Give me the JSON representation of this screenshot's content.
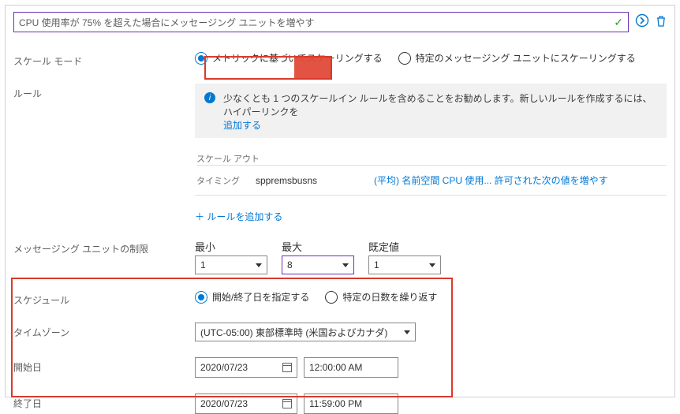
{
  "title_input": "CPU 使用率が 75% を超えた場合にメッセージング ユニットを増やす",
  "labels": {
    "scale_mode": "スケール モード",
    "rules": "ルール",
    "unit_limit": "メッセージング ユニットの制限",
    "schedule": "スケジュール",
    "timezone": "タイムゾーン",
    "start_date": "開始日",
    "end_date": "終了日"
  },
  "scale_mode": {
    "opt_metric": "メトリックに基づいてスケーリングする",
    "opt_specific": "特定のメッセージング ユニットにスケーリングする"
  },
  "info": {
    "text": "少なくとも 1 つのスケールイン ルールを含めることをお勧めします。新しいルールを作成するには、ハイパーリンクを",
    "add_link": "追加する"
  },
  "rules_section": {
    "scale_out": "スケール アウト",
    "timing_label": "タイミング",
    "timing_source": "sppremsbusns",
    "timing_detail": "(平均) 名前空間 CPU 使用... 許可された次の値を増やす",
    "add_rule": "＋ ルールを追加する"
  },
  "limits": {
    "min_label": "最小",
    "min_value": "1",
    "max_label": "最大",
    "max_value": "8",
    "default_label": "既定値",
    "default_value": "1"
  },
  "schedule": {
    "opt_dates": "開始/終了日を指定する",
    "opt_repeat": "特定の日数を繰り返す"
  },
  "timezone_value": "(UTC-05:00) 東部標準時 (米国およびカナダ)",
  "start": {
    "date": "2020/07/23",
    "time": "12:00:00 AM"
  },
  "end": {
    "date": "2020/07/23",
    "time": "11:59:00 PM"
  }
}
